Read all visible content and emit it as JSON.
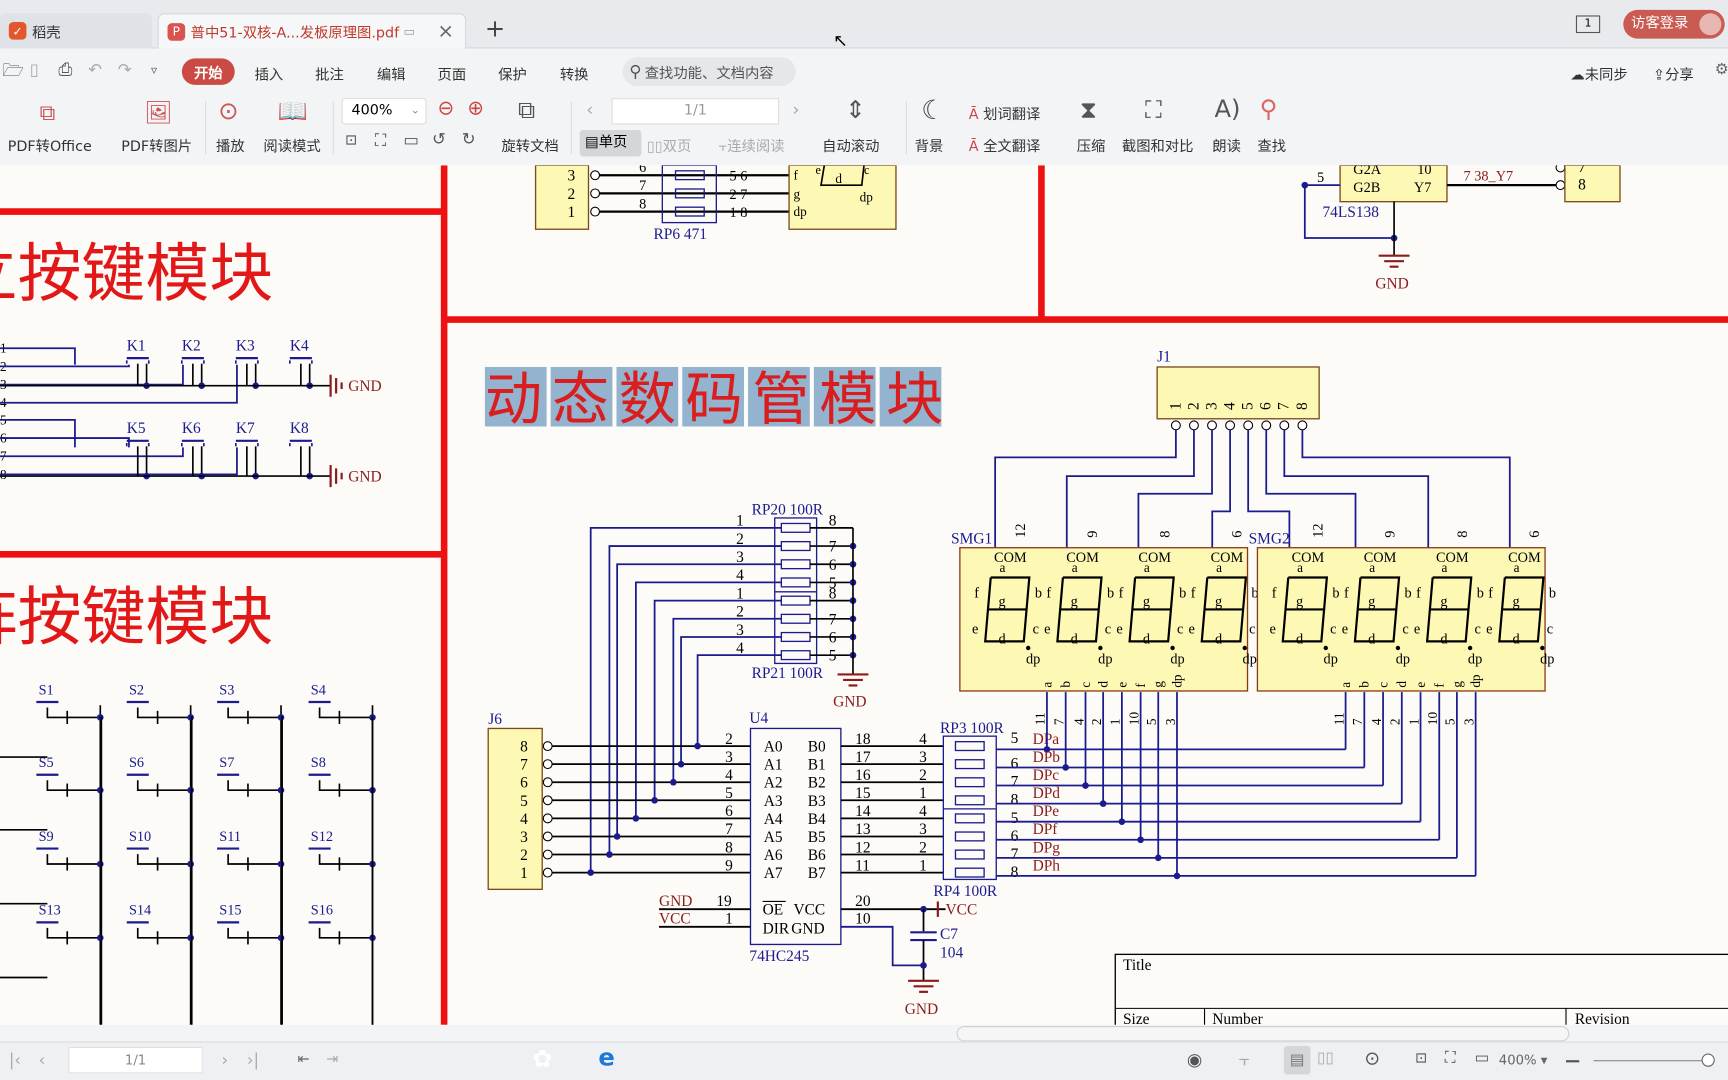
{
  "tabs": {
    "home": "稻壳",
    "doc": "普中51-双核-A...发板原理图.pdf",
    "new_tab": "+",
    "close": "×"
  },
  "account": {
    "pages_badge": "1",
    "login": "访客登录"
  },
  "menu": {
    "items": [
      "开始",
      "插入",
      "批注",
      "编辑",
      "页面",
      "保护",
      "转换"
    ],
    "search_placeholder": "查找功能、文档内容",
    "sync": "未同步",
    "share": "分享"
  },
  "ribbon": {
    "pdf_to_office": "PDF转Office",
    "pdf_to_image": "PDF转图片",
    "play": "播放",
    "read_mode": "阅读模式",
    "zoom": "400%",
    "rotate": "旋转文档",
    "page": "1/1",
    "single": "单页",
    "double": "双页",
    "continuous": "连续阅读",
    "auto_scroll": "自动滚动",
    "background": "背景",
    "word_translate": "划词翻译",
    "full_translate": "全文翻译",
    "compress": "压缩",
    "screenshot_compare": "截图和对比",
    "read_aloud": "朗读",
    "find": "查找"
  },
  "status": {
    "page": "1/1",
    "zoom": "400%"
  },
  "schematic": {
    "section_titles": {
      "independent_keys": "独立按键模块",
      "matrix_keys": "矩阵按键模块",
      "dynamic_display": "动态数码管模块"
    },
    "top": {
      "rp6": "RP6   471",
      "rp6_left": [
        "6",
        "7",
        "8"
      ],
      "rp6_right": [
        "5  6",
        "2  7",
        "1  8"
      ],
      "conn_pins": [
        "3",
        "2",
        "1"
      ],
      "seg": [
        "f",
        "g",
        "dp",
        "e",
        "d",
        "c",
        "dp"
      ],
      "ic138": "74LS138",
      "g2a": "G2A",
      "g2b": "G2B",
      "y7": "Y7",
      "pin10": "10",
      "pin5": "5",
      "net": "7   38_Y7",
      "pin8": "8",
      "pin7": "7",
      "gnd": "GND"
    },
    "keys": {
      "pins": [
        "1",
        "2",
        "3",
        "4",
        "5",
        "6",
        "7",
        "8"
      ],
      "k": [
        "K1",
        "K2",
        "K3",
        "K4",
        "K5",
        "K6",
        "K7",
        "K8"
      ],
      "gnd": "GND"
    },
    "matrix": {
      "s": [
        "S1",
        "S2",
        "S3",
        "S4",
        "S5",
        "S6",
        "S7",
        "S8",
        "S9",
        "S10",
        "S11",
        "S12",
        "S13",
        "S14",
        "S15",
        "S16"
      ]
    },
    "j1": {
      "name": "J1",
      "pins": [
        "1",
        "2",
        "3",
        "4",
        "5",
        "6",
        "7",
        "8"
      ]
    },
    "rp20": "RP20  100R",
    "rp21": "RP21  100R",
    "rp_left": [
      "1",
      "2",
      "3",
      "4",
      "1",
      "2",
      "3",
      "4"
    ],
    "rp_right": [
      "8",
      "7",
      "6",
      "5",
      "8",
      "7",
      "6",
      "5"
    ],
    "gnd": "GND",
    "vcc": "VCC",
    "j6": {
      "name": "J6",
      "pins": [
        "8",
        "7",
        "6",
        "5",
        "4",
        "3",
        "2",
        "1"
      ]
    },
    "u4": {
      "name": "U4",
      "part": "74HC245",
      "a_pins": [
        "A0",
        "A1",
        "A2",
        "A3",
        "A4",
        "A5",
        "A6",
        "A7"
      ],
      "b_pins": [
        "B0",
        "B1",
        "B2",
        "B3",
        "B4",
        "B5",
        "B6",
        "B7"
      ],
      "a_nums": [
        "2",
        "3",
        "4",
        "5",
        "6",
        "7",
        "8",
        "9"
      ],
      "b_nums": [
        "18",
        "17",
        "16",
        "15",
        "14",
        "13",
        "12",
        "11"
      ],
      "oe": "OE",
      "vcc_pin": "VCC",
      "dir": "DIR",
      "gnd_pin": "GND",
      "n19": "19",
      "n1": "1",
      "n20": "20",
      "n10": "10"
    },
    "rp3": "RP3   100R",
    "rp4": "RP4  100R",
    "rp3_left": [
      "4",
      "3",
      "2",
      "1",
      "4",
      "3",
      "2",
      "1"
    ],
    "rp3_right": [
      "5",
      "6",
      "7",
      "8",
      "5",
      "6",
      "7",
      "8"
    ],
    "nets": [
      "DPa",
      "DPb",
      "DPc",
      "DPd",
      "DPe",
      "DPf",
      "DPg",
      "DPh"
    ],
    "c7": "C7",
    "c7_val": "104",
    "smg": {
      "names": [
        "SMG1",
        "SMG2"
      ],
      "com": "COM",
      "com_pins": [
        "12",
        "9",
        "8",
        "6"
      ],
      "seg_pins": [
        "a",
        "b",
        "c",
        "d",
        "e",
        "f",
        "g",
        "dp"
      ],
      "seg_nums": [
        "11",
        "7",
        "4",
        "2",
        "1",
        "10",
        "5",
        "3"
      ],
      "segs": [
        "a",
        "b",
        "c",
        "d",
        "e",
        "f",
        "g",
        "dp"
      ]
    },
    "title_block": {
      "title": "Title",
      "size": "Size",
      "number": "Number",
      "revision": "Revision"
    }
  },
  "colors": {
    "accent": "#c94b43",
    "border_red": "#ee1111",
    "wire_blue": "#1b1b8f",
    "part_fill": "#fdf8b4",
    "net_red": "#8b1c1c",
    "highlight": "#93b3cf"
  }
}
